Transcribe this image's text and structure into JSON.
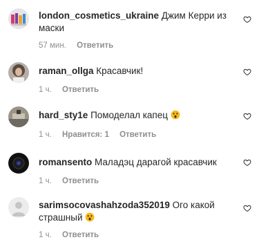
{
  "comments": [
    {
      "username": "london_cosmetics_ukraine",
      "text": "Джим Керри из маски",
      "time": "57 мин.",
      "likes": "",
      "reply_label": "Ответить",
      "emoji": ""
    },
    {
      "username": "raman_ollga",
      "text": "Красавчик!",
      "time": "1 ч.",
      "likes": "",
      "reply_label": "Ответить",
      "emoji": ""
    },
    {
      "username": "hard_sty1e",
      "text": "Помоделал капец",
      "time": "1 ч.",
      "likes": "Нравится: 1",
      "reply_label": "Ответить",
      "emoji": "astonished-face"
    },
    {
      "username": "romansento",
      "text": "Маладэц дарагой красавчик",
      "time": "1 ч.",
      "likes": "",
      "reply_label": "Ответить",
      "emoji": ""
    },
    {
      "username": "sarimsocovashahzoda352019",
      "text": "Ого какой страшный",
      "time": "1 ч.",
      "likes": "",
      "reply_label": "Ответить",
      "emoji": "astonished-face"
    }
  ],
  "colors": {
    "text": "#262626",
    "meta": "#8e8e8e",
    "emoji": "#f5b91e"
  }
}
